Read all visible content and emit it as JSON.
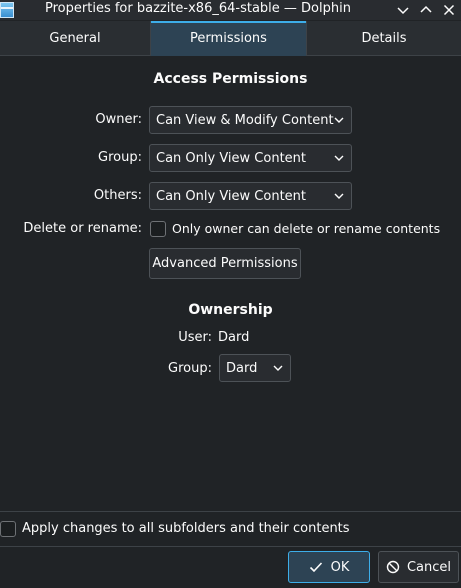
{
  "window": {
    "title": "Properties for bazzite-x86_64-stable — Dolphin",
    "app_icon": "folder-icon",
    "controls": [
      "chevron-down-icon",
      "chevron-up-icon",
      "close-icon"
    ]
  },
  "tabs": [
    {
      "label": "General"
    },
    {
      "label": "Permissions",
      "active": true
    },
    {
      "label": "Details"
    }
  ],
  "access": {
    "heading": "Access Permissions",
    "owner": {
      "label": "Owner:",
      "value": "Can View & Modify Content"
    },
    "group": {
      "label": "Group:",
      "value": "Can Only View Content"
    },
    "others": {
      "label": "Others:",
      "value": "Can Only View Content"
    },
    "delete_rename": {
      "label": "Delete or rename:",
      "checkbox_text": "Only owner can delete or rename contents",
      "checked": false
    },
    "advanced_button": "Advanced Permissions"
  },
  "ownership": {
    "heading": "Ownership",
    "user_label": "User:",
    "user_value": "Dard",
    "group_label": "Group:",
    "group_value": "Dard"
  },
  "footer": {
    "apply_text": "Apply changes to all subfolders and their contents",
    "apply_checked": false,
    "ok_label": "OK",
    "cancel_label": "Cancel"
  },
  "colors": {
    "background": "#202326",
    "accent": "#3daee9",
    "tab_active": "#2d4354"
  }
}
